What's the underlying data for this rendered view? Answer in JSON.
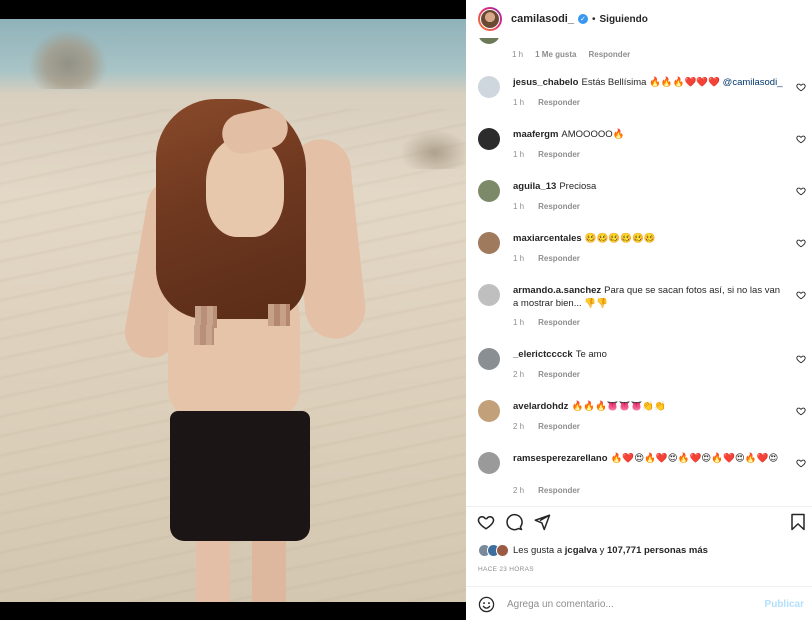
{
  "post": {
    "username": "camilasodi_",
    "follow_status": "Siguiendo",
    "separator": "•",
    "verified_mark": "✓"
  },
  "top_comment_meta": {
    "time": "1 h",
    "likes": "1 Me gusta",
    "reply": "Responder"
  },
  "comments": [
    {
      "username": "jesus_chabelo",
      "text": "Estás Bellísima 🔥🔥🔥❤️❤️❤️ ",
      "mention": "@camilasodi_",
      "time": "1 h",
      "reply": "Responder",
      "avatar_color": "#cfd7de"
    },
    {
      "username": "maafergm",
      "text": "AMOOOOO🔥",
      "time": "1 h",
      "reply": "Responder",
      "avatar_color": "#2c2c2c"
    },
    {
      "username": "aguila_13",
      "text": "Preciosa",
      "time": "1 h",
      "reply": "Responder",
      "avatar_color": "#7d8a6a"
    },
    {
      "username": "maxiarcentales",
      "text": "🥴🥴🥴🥴🥴🥴",
      "time": "1 h",
      "reply": "Responder",
      "avatar_color": "#a07a5c"
    },
    {
      "username": "armando.a.sanchez",
      "text": "Para que se sacan fotos así, si no las van a mostrar bien... 👎👎",
      "time": "1 h",
      "reply": "Responder",
      "avatar_color": "#bfbfbf"
    },
    {
      "username": "_elerictcccck",
      "text": "Te amo",
      "time": "2 h",
      "reply": "Responder",
      "avatar_color": "#8a8f93"
    },
    {
      "username": "avelardohdz",
      "text": "🔥🔥🔥👅👅👅👏👏",
      "time": "2 h",
      "reply": "Responder",
      "avatar_color": "#c2a07a"
    },
    {
      "username": "ramsesperezarellano",
      "text": "🔥❤️😍🔥❤️😍🔥❤️😍🔥❤️😍🔥❤️😍",
      "time": "2 h",
      "reply": "Responder",
      "avatar_color": "#9a9a9a"
    }
  ],
  "likes": {
    "prefix": "Les gusta a",
    "user": "jcgalva",
    "middle": "y",
    "count": "107,771 personas más"
  },
  "timestamp": "HACE 23 HORAS",
  "composer": {
    "placeholder": "Agrega un comentario...",
    "post_label": "Publicar"
  },
  "icons": {
    "like": "heart-icon",
    "comment": "comment-icon",
    "share": "share-icon",
    "save": "bookmark-icon",
    "emoji": "emoji-icon",
    "comment_like": "small-heart-icon"
  }
}
